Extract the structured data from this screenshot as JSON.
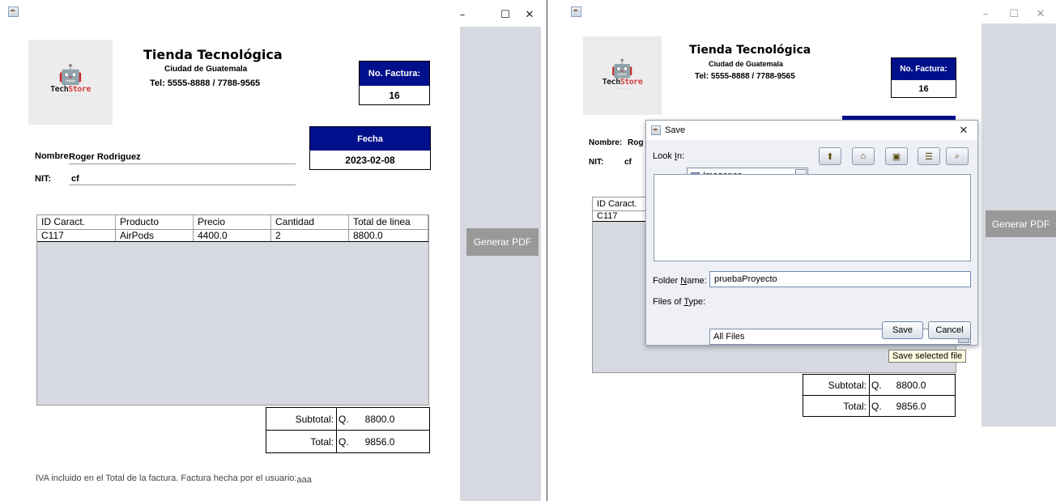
{
  "store": {
    "name": "Tienda Tecnológica",
    "city": "Ciudad de Guatemala",
    "phone": "Tel: 5555-8888 / 7788-9565",
    "logo_text_a": "Tech",
    "logo_text_b": "Store",
    "logo_small": "· · · · · ·"
  },
  "invoice": {
    "number_label": "No. Factura:",
    "number": "16",
    "date_label": "Fecha",
    "date": "2023-02-08",
    "name_label": "Nombre:",
    "name": "Roger Rodriguez",
    "nit_label": "NIT:",
    "nit": "cf",
    "columns": [
      "ID Caract.",
      "Producto",
      "Precio",
      "Cantidad",
      "Total de linea"
    ],
    "rows": [
      [
        "C117",
        "AirPods",
        "4400.0",
        "2",
        "8800.0"
      ]
    ],
    "subtotal_label": "Subtotal:",
    "subtotal_currency": "Q.",
    "subtotal": "8800.0",
    "total_label": "Total:",
    "total_currency": "Q.",
    "total": "9856.0",
    "footer": "IVA incluido en el Total de la factura. Factura hecha por el usuario:",
    "user": "aaa"
  },
  "actions": {
    "generate_pdf": "Generar PDF"
  },
  "window_controls": {
    "minimize": "–",
    "maximize": "☐",
    "close": "✕"
  },
  "dialog": {
    "title": "Save",
    "look_in_label": "Look In:",
    "look_in_value": "Imagenes",
    "folder_name_label": "Folder Name:",
    "folder_name_value": "pruebaProyecto",
    "files_type_label": "Files of Type:",
    "files_type_value": "All Files",
    "save": "Save",
    "cancel": "Cancel",
    "tooltip": "Save selected file",
    "close": "✕"
  }
}
